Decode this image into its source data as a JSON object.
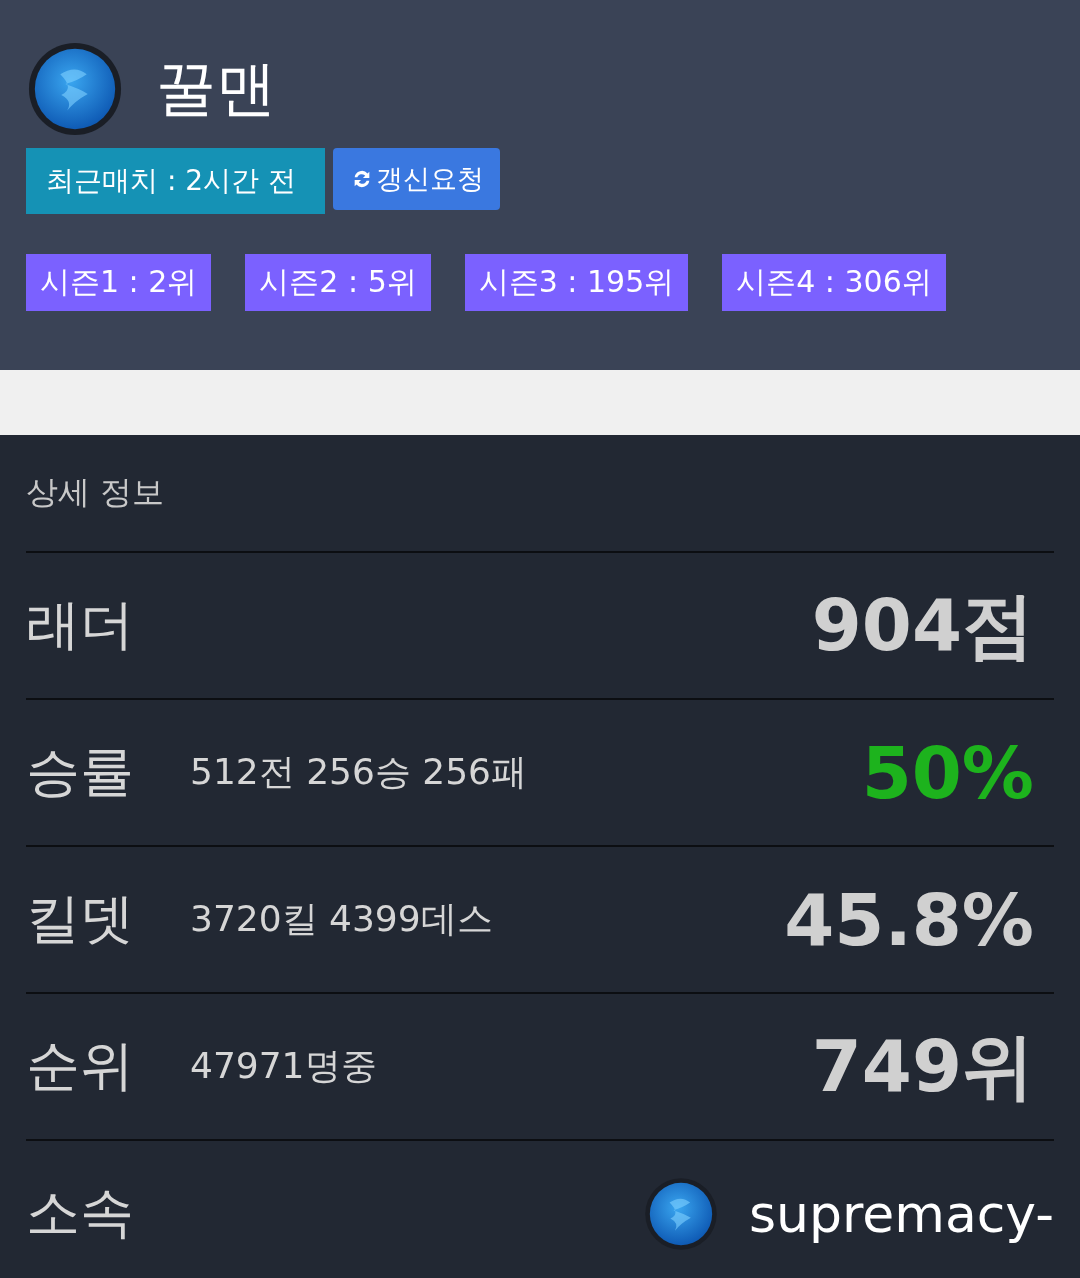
{
  "profile": {
    "name": "꿀맨",
    "last_match": "최근매치 : 2시간 전",
    "refresh_button": "갱신요청"
  },
  "seasons": [
    "시즌1 : 2위",
    "시즌2 : 5위",
    "시즌3 : 195위",
    "시즌4 : 306위"
  ],
  "details": {
    "title": "상세 정보",
    "rows": [
      {
        "kind": "stat",
        "label": "래더",
        "detail": null,
        "value": "904점",
        "color": "#d0d0d0"
      },
      {
        "kind": "stat",
        "label": "승률",
        "detail": "512전 256승 256패",
        "value": "50%",
        "color": "#1db31d"
      },
      {
        "kind": "stat",
        "label": "킬뎃",
        "detail": "3720킬 4399데스",
        "value": "45.8%",
        "color": "#d0d0d0"
      },
      {
        "kind": "stat",
        "label": "순위",
        "detail": "47971명중",
        "value": "749위",
        "color": "#d0d0d0"
      },
      {
        "kind": "team",
        "label": "소속",
        "team": "supremacy-"
      }
    ]
  }
}
